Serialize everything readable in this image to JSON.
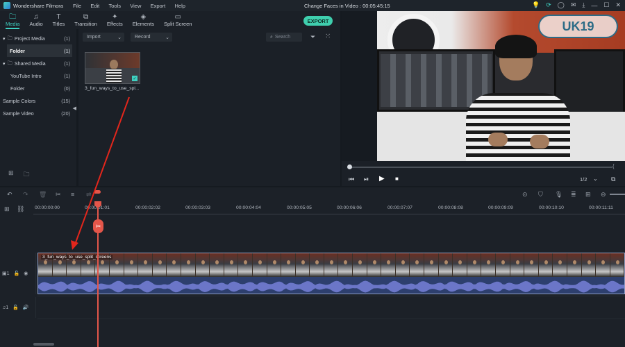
{
  "app": {
    "name": "Wondershare Filmora",
    "project_title": "Change Faces in Video : 00:05:45:15"
  },
  "menu": [
    "File",
    "Edit",
    "Tools",
    "View",
    "Export",
    "Help"
  ],
  "tabs": [
    {
      "label": "Media",
      "icon": "folder-icon",
      "active": true
    },
    {
      "label": "Audio",
      "icon": "music-note-icon"
    },
    {
      "label": "Titles",
      "icon": "text-icon"
    },
    {
      "label": "Transition",
      "icon": "transition-icon"
    },
    {
      "label": "Effects",
      "icon": "effects-icon"
    },
    {
      "label": "Elements",
      "icon": "elements-icon"
    },
    {
      "label": "Split Screen",
      "icon": "split-screen-icon"
    }
  ],
  "export_label": "EXPORT",
  "sidebar": {
    "items": [
      {
        "label": "Project Media",
        "count": "(1)"
      },
      {
        "label": "Folder",
        "count": "(1)"
      },
      {
        "label": "Shared Media",
        "count": "(1)"
      },
      {
        "label": "YouTube Intro",
        "count": "(1)"
      },
      {
        "label": "Folder",
        "count": "(0)"
      },
      {
        "label": "Sample Colors",
        "count": "(15)"
      },
      {
        "label": "Sample Video",
        "count": "(20)"
      }
    ]
  },
  "media_toolbar": {
    "import": "Import",
    "record": "Record",
    "search_placeholder": "Search"
  },
  "media_item": {
    "name": "3_fun_ways_to_use_spl..."
  },
  "preview": {
    "page": "1/2"
  },
  "ruler_ticks": [
    "00:00:00:00",
    "00:00:01:01",
    "00:00:02:02",
    "00:00:03:03",
    "00:00:04:04",
    "00:00:05:05",
    "00:00:06:06",
    "00:00:07:07",
    "00:00:08:08",
    "00:00:09:09",
    "00:00:10:10",
    "00:00:11:11"
  ],
  "clip": {
    "name": "3_fun_ways_to_use_split_screens"
  },
  "watermark": "UK19"
}
